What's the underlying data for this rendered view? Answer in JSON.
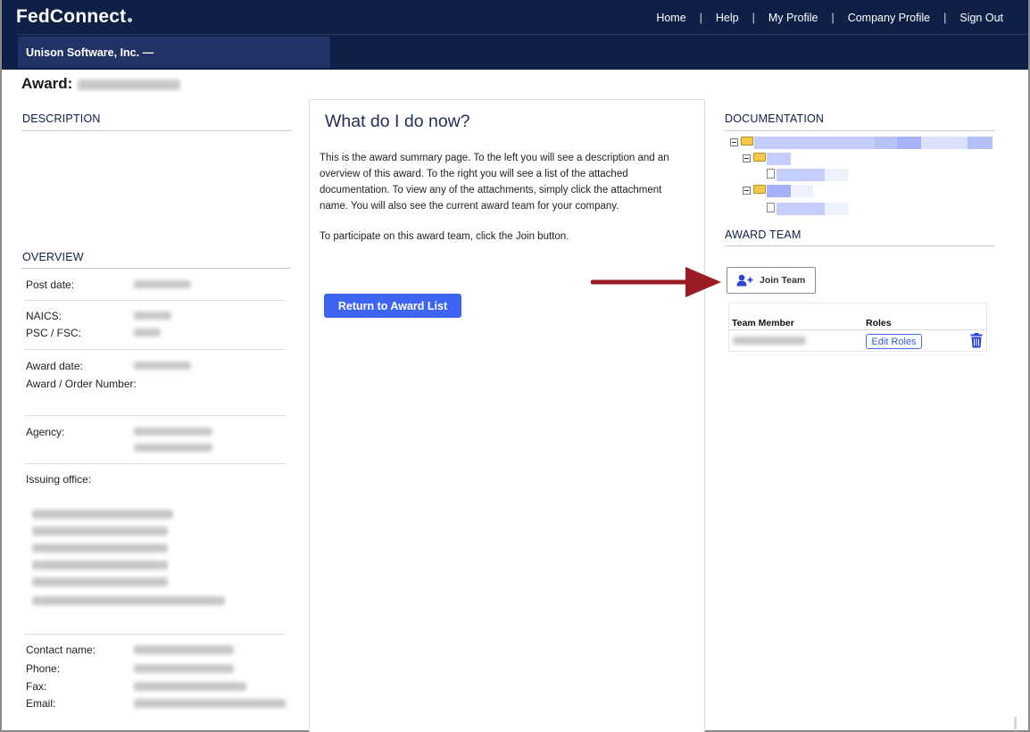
{
  "header": {
    "logo": "FedConnect",
    "nav": [
      {
        "label": "Home"
      },
      {
        "label": "Help"
      },
      {
        "label": "My Profile"
      },
      {
        "label": "Company Profile"
      },
      {
        "label": "Sign Out"
      }
    ],
    "nav_separator": "|",
    "company": "Unison Software, Inc. —"
  },
  "award": {
    "label": "Award:"
  },
  "left": {
    "description_heading": "DESCRIPTION",
    "overview_heading": "OVERVIEW",
    "labels": {
      "post_date": "Post date:",
      "naics": "NAICS:",
      "psc_fsc": "PSC / FSC:",
      "award_date": "Award date:",
      "award_order_number": "Award / Order Number:",
      "agency": "Agency:",
      "issuing_office": "Issuing office:",
      "contact_name": "Contact name:",
      "phone": "Phone:",
      "fax": "Fax:",
      "email": "Email:"
    }
  },
  "center": {
    "title": "What do I do now?",
    "paragraph1": "This is the award summary page. To the left you will see a description and an overview of this award. To the right you will see a list of the attached documentation. To view any of the attachments, simply click the attachment name. You will also see the current award team for your company.",
    "paragraph2": "To participate on this award team, click the Join button.",
    "return_button": "Return to Award List"
  },
  "right": {
    "documentation_heading": "DOCUMENTATION",
    "award_team_heading": "AWARD TEAM",
    "join_button": "Join Team",
    "table": {
      "col_member": "Team Member",
      "col_roles": "Roles",
      "edit_roles": "Edit Roles"
    }
  },
  "colors": {
    "header_bg": "#0f2047",
    "company_bar": "#213366",
    "primary_button": "#3d64f2",
    "arrow": "#9b1c24",
    "trash": "#2a44d6"
  },
  "icons": {
    "join": "user-plus-icon",
    "trash": "trash-icon",
    "folder": "folder-icon",
    "document": "document-icon",
    "collapse": "minus-box-icon"
  }
}
